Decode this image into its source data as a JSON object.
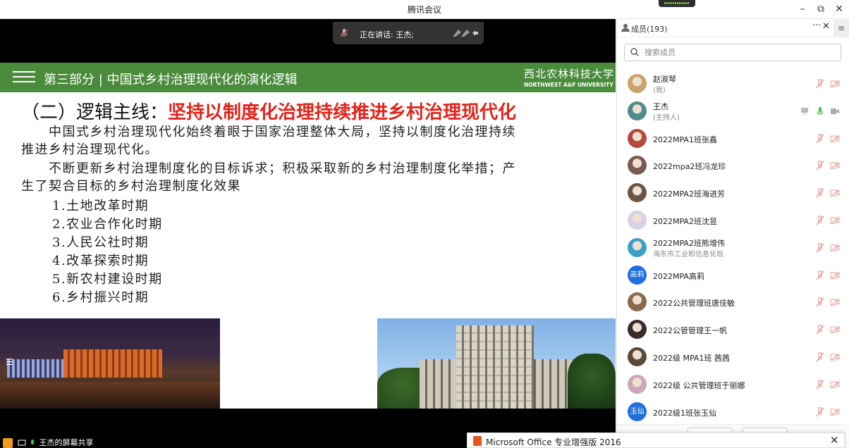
{
  "window": {
    "title": "腾讯会议"
  },
  "speaking": {
    "label": "正在讲话: 王杰;"
  },
  "slide": {
    "bar_title": "第三部分 | 中国式乡村治理现代化的演化逻辑",
    "logo_cn": "西北农林科技大学",
    "logo_en": "NORTHWEST A&F UNIVERSITY",
    "heading_black": "（二）逻辑主线：",
    "heading_red": "坚持以制度化治理持续推进乡村治理现代化",
    "para1_line1": "　　中国式乡村治理现代化始终着眼于国家治理整体大局，坚持以制度化治理持续",
    "para1_line2": "推进乡村治理现代化。",
    "para2_line1": "　　不断更新乡村治理制度化的目标诉求；积极采取新的乡村治理制度化举措；产",
    "para2_line2": "生了契合目标的乡村治理制度化效果",
    "list": [
      "1.土地改革时期",
      "2.农业合作化时期",
      "3.人民公社时期",
      "4.改革探索时期",
      "5.新农村建设时期",
      "6.乡村振兴时期"
    ]
  },
  "screenshare": {
    "label": "王杰的屏幕共享"
  },
  "panel": {
    "member_count": "成员(193)",
    "search_placeholder": "搜索成员",
    "members": [
      {
        "name": "赵淑琴",
        "sub": "(我)"
      },
      {
        "name": "王杰",
        "sub": "(主持人)"
      },
      {
        "name": "2022MPA1班张鑫"
      },
      {
        "name": "2022mpa2班冯龙珍"
      },
      {
        "name": "2022MPA2班海进芳"
      },
      {
        "name": "2022MPA2班沈昱"
      },
      {
        "name": "2022MPA2班熊增伟",
        "sub": "海东市工业和信息化局"
      },
      {
        "name": "2022MPA高莉",
        "avatar_text": "高莉",
        "avatar_color": "#1f6fe0"
      },
      {
        "name": "2022公共管理班唐佳敏"
      },
      {
        "name": "2022公管管理王一帆"
      },
      {
        "name": "2022级 MPA1班 茜茜"
      },
      {
        "name": "2022级 公共管理班于丽娜"
      },
      {
        "name": "2022级1班张玉仙",
        "avatar_text": "玉仙",
        "avatar_color": "#1f6fe0"
      }
    ]
  },
  "office": {
    "title": "Microsoft Office 专业增强版 2016"
  }
}
